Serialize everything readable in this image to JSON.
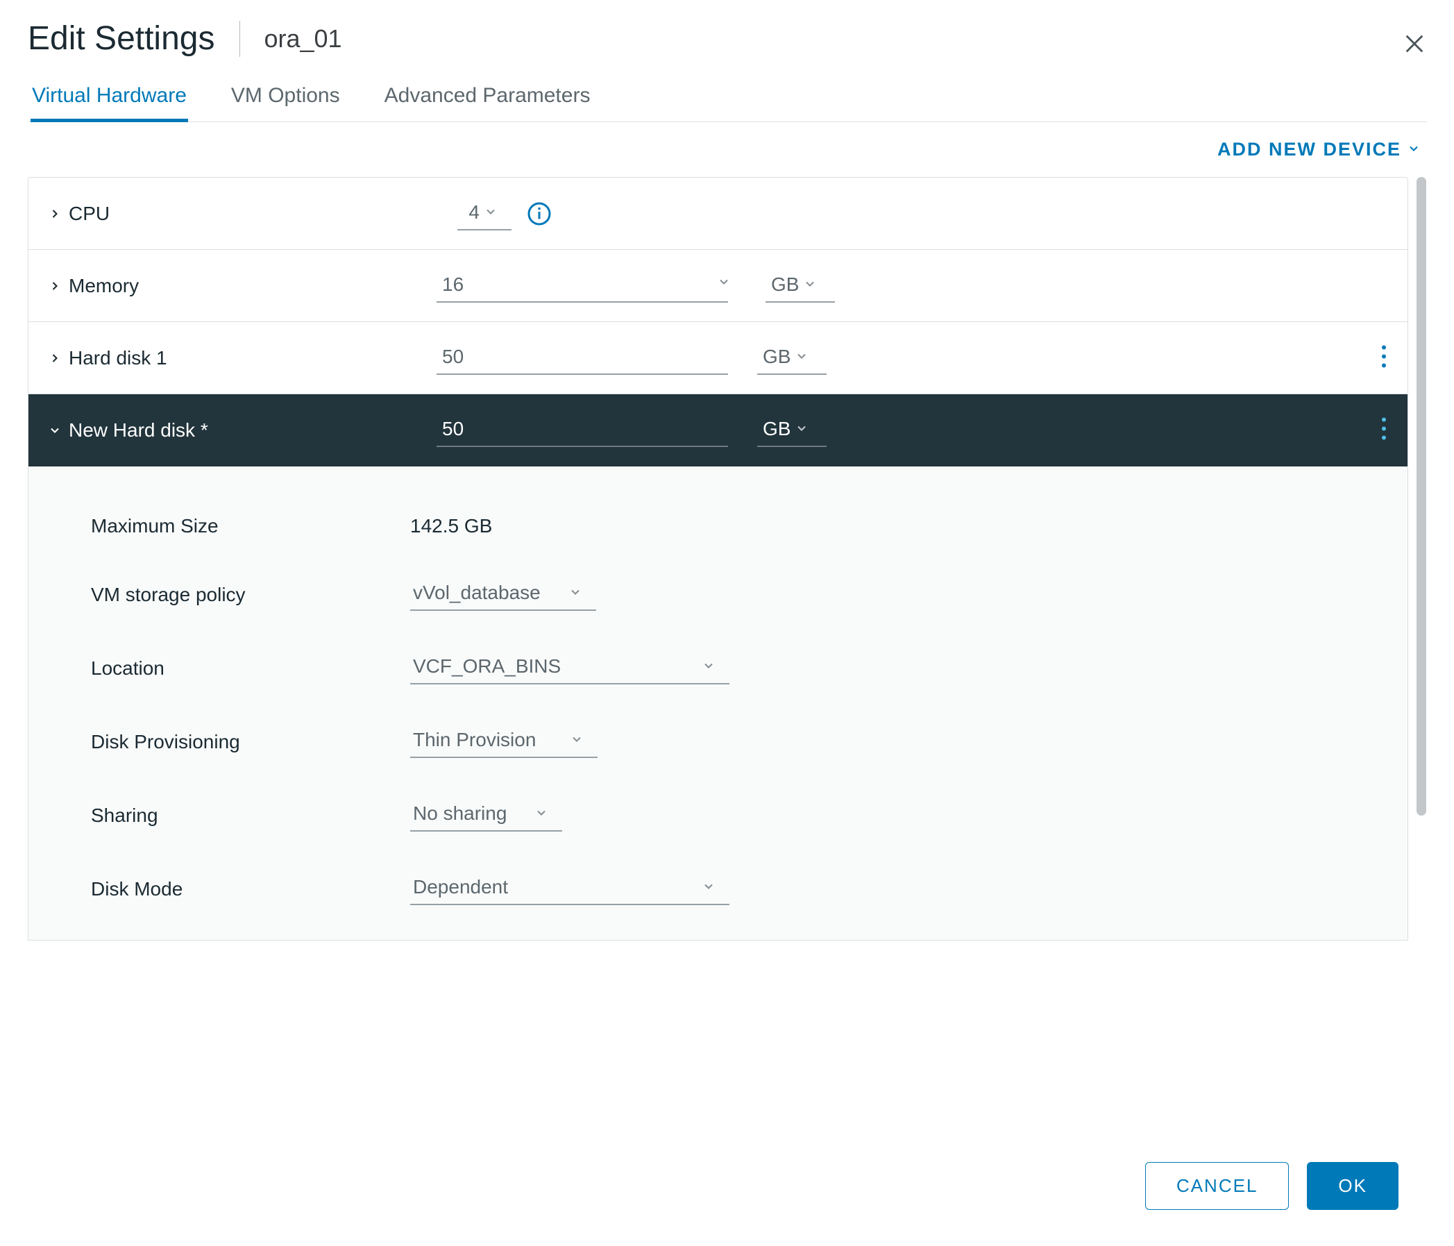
{
  "dialog": {
    "title": "Edit Settings",
    "subtitle": "ora_01"
  },
  "tabs": {
    "virtual_hardware": "Virtual Hardware",
    "vm_options": "VM Options",
    "advanced_parameters": "Advanced Parameters"
  },
  "actions": {
    "add_new_device": "ADD NEW DEVICE"
  },
  "hardware": {
    "cpu": {
      "label": "CPU",
      "value": "4"
    },
    "memory": {
      "label": "Memory",
      "value": "16",
      "unit": "GB"
    },
    "hard_disk_1": {
      "label": "Hard disk 1",
      "value": "50",
      "unit": "GB"
    },
    "new_hard_disk": {
      "label": "New Hard disk *",
      "value": "50",
      "unit": "GB"
    }
  },
  "new_disk_detail": {
    "max_size_label": "Maximum Size",
    "max_size_value": "142.5 GB",
    "vm_storage_label": "VM storage policy",
    "vm_storage_value": "vVol_database",
    "location_label": "Location",
    "location_value": "VCF_ORA_BINS",
    "provisioning_label": "Disk Provisioning",
    "provisioning_value": "Thin Provision",
    "sharing_label": "Sharing",
    "sharing_value": "No sharing",
    "disk_mode_label": "Disk Mode",
    "disk_mode_value": "Dependent"
  },
  "footer": {
    "cancel": "CANCEL",
    "ok": "OK"
  }
}
